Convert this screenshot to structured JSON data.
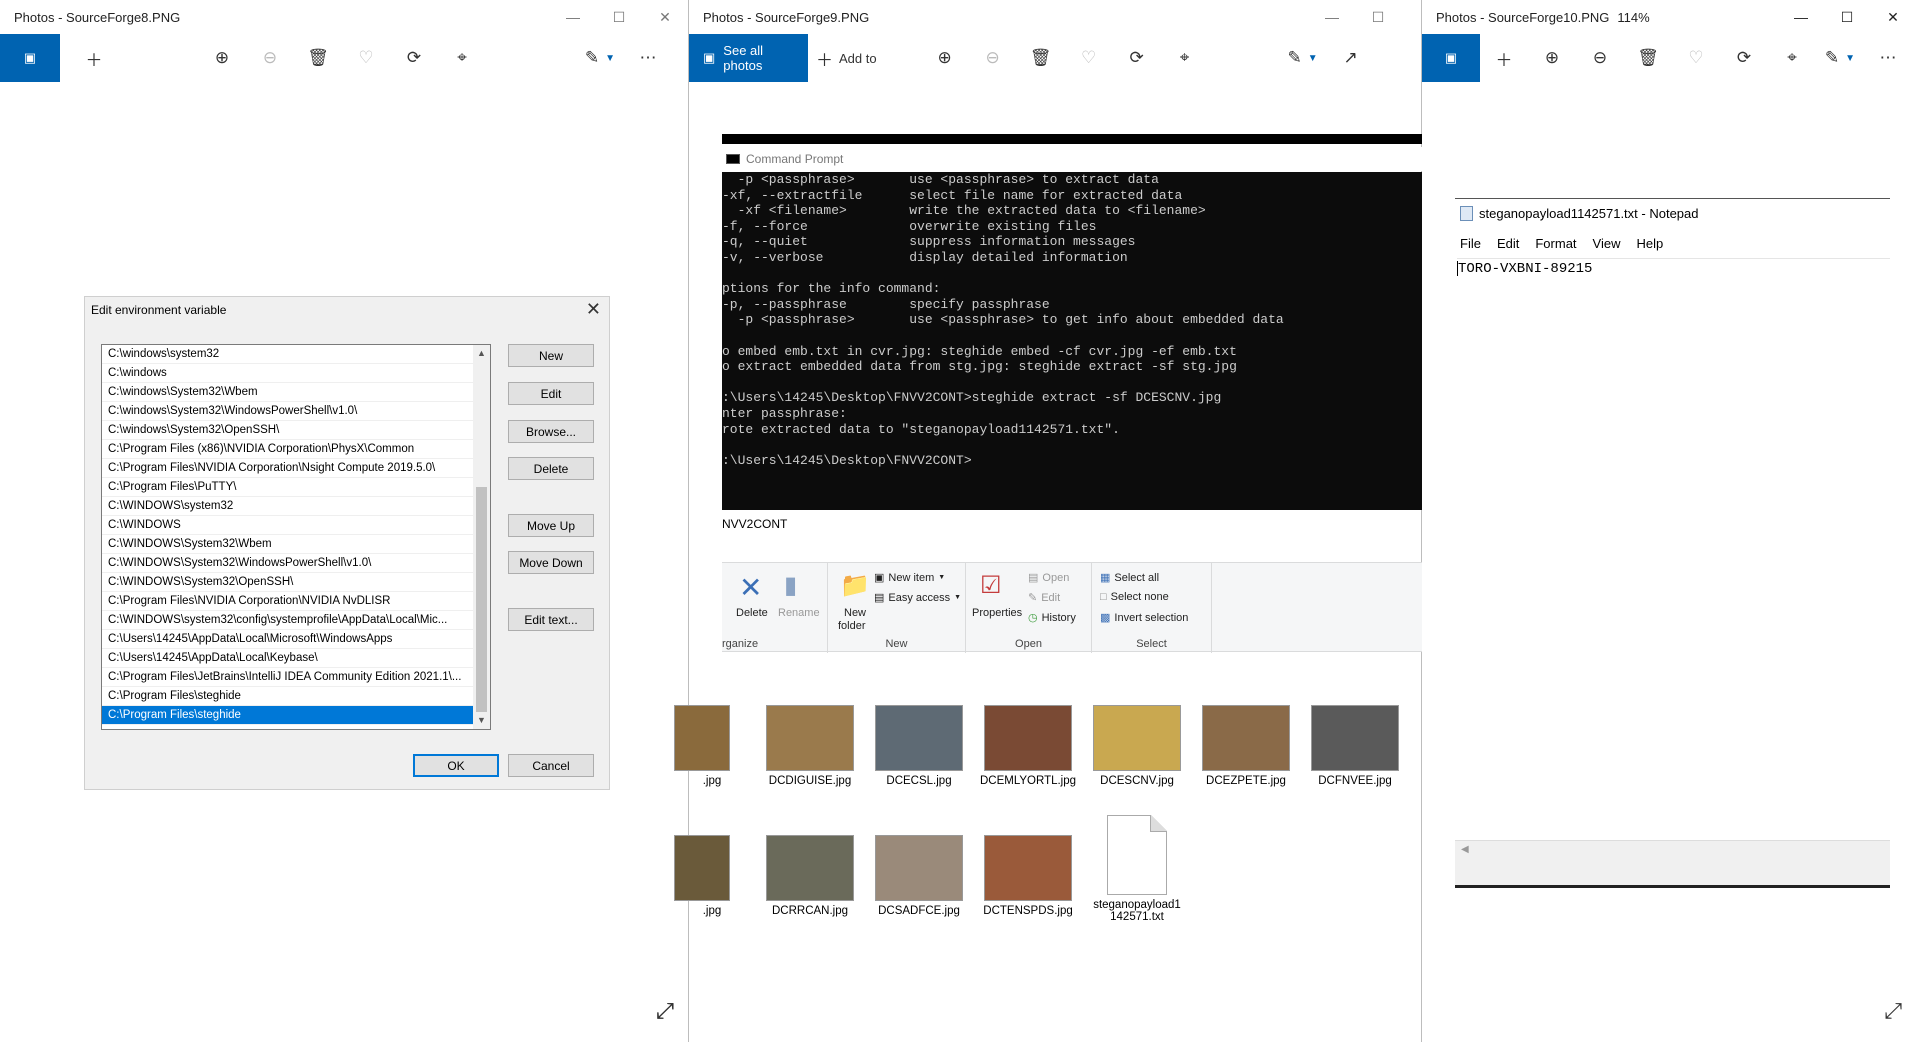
{
  "windows": {
    "w1": {
      "title": "Photos - SourceForge8.PNG"
    },
    "w2": {
      "title": "Photos - SourceForge9.PNG",
      "see_all": "See all photos",
      "add_to": "Add to"
    },
    "w3": {
      "title": "Photos - SourceForge10.PNG",
      "zoom": "114%"
    }
  },
  "env_dialog": {
    "title": "Edit environment variable",
    "paths": [
      "C:\\windows\\system32",
      "C:\\windows",
      "C:\\windows\\System32\\Wbem",
      "C:\\windows\\System32\\WindowsPowerShell\\v1.0\\",
      "C:\\windows\\System32\\OpenSSH\\",
      "C:\\Program Files (x86)\\NVIDIA Corporation\\PhysX\\Common",
      "C:\\Program Files\\NVIDIA Corporation\\Nsight Compute 2019.5.0\\",
      "C:\\Program Files\\PuTTY\\",
      "C:\\WINDOWS\\system32",
      "C:\\WINDOWS",
      "C:\\WINDOWS\\System32\\Wbem",
      "C:\\WINDOWS\\System32\\WindowsPowerShell\\v1.0\\",
      "C:\\WINDOWS\\System32\\OpenSSH\\",
      "C:\\Program Files\\NVIDIA Corporation\\NVIDIA NvDLISR",
      "C:\\WINDOWS\\system32\\config\\systemprofile\\AppData\\Local\\Mic...",
      "C:\\Users\\14245\\AppData\\Local\\Microsoft\\WindowsApps",
      "C:\\Users\\14245\\AppData\\Local\\Keybase\\",
      "C:\\Program Files\\JetBrains\\IntelliJ IDEA Community Edition 2021.1\\...",
      "C:\\Program Files\\steghide",
      "C:\\Program Files\\steghide"
    ],
    "selected_index": 19,
    "buttons": {
      "new": "New",
      "edit": "Edit",
      "browse": "Browse...",
      "delete": "Delete",
      "move_up": "Move Up",
      "move_down": "Move Down",
      "edit_text": "Edit text...",
      "ok": "OK",
      "cancel": "Cancel"
    }
  },
  "command_prompt": {
    "title": "Command Prompt",
    "lines": [
      "  -p <passphrase>       use <passphrase> to extract data",
      "-xf, --extractfile      select file name for extracted data",
      "  -xf <filename>        write the extracted data to <filename>",
      "-f, --force             overwrite existing files",
      "-q, --quiet             suppress information messages",
      "-v, --verbose           display detailed information",
      "",
      "ptions for the info command:",
      "-p, --passphrase        specify passphrase",
      "  -p <passphrase>       use <passphrase> to get info about embedded data",
      "",
      "o embed emb.txt in cvr.jpg: steghide embed -cf cvr.jpg -ef emb.txt",
      "o extract embedded data from stg.jpg: steghide extract -sf stg.jpg",
      "",
      ":\\Users\\14245\\Desktop\\FNVV2CONT>steghide extract -sf DCESCNV.jpg",
      "nter passphrase:",
      "rote extracted data to \"steganopayload1142571.txt\".",
      "",
      ":\\Users\\14245\\Desktop\\FNVV2CONT>"
    ]
  },
  "explorer": {
    "address": "NVV2CONT",
    "ribbon": {
      "delete": "Delete",
      "rename": "Rename",
      "organize": "rganize",
      "new_folder_1": "New",
      "new_folder_2": "folder",
      "new_item": "New item",
      "easy_access": "Easy access",
      "new_group": "New",
      "properties": "Properties",
      "open": "Open",
      "edit": "Edit",
      "history": "History",
      "open_group": "Open",
      "select_all": "Select all",
      "select_none": "Select none",
      "invert_selection": "Invert selection",
      "select_group": "Select"
    },
    "row1": [
      ".jpg",
      "DCDIGUISE.jpg",
      "DCECSL.jpg",
      "DCEMLYORTL.jpg",
      "DCESCNV.jpg",
      "DCEZPETE.jpg",
      "DCFNVEE.jpg"
    ],
    "row2": [
      ".jpg",
      "DCRRCAN.jpg",
      "DCSADFCE.jpg",
      "DCTENSPDS.jpg"
    ],
    "txt_file_1": "steganopayload1",
    "txt_file_2": "142571.txt",
    "thumb_colors": [
      "#8a6a3c",
      "#9a7a4c",
      "#5e6a74",
      "#7a4a34",
      "#c9a850",
      "#8a6a48",
      "#5a5a5a",
      "#6a5a3a",
      "#6a6a5a",
      "#9a8a7a",
      "#9a5a3a"
    ]
  },
  "notepad": {
    "title": "steganopayload1142571.txt - Notepad",
    "menu": [
      "File",
      "Edit",
      "Format",
      "View",
      "Help"
    ],
    "content": "TORO-VXBNI-89215"
  }
}
